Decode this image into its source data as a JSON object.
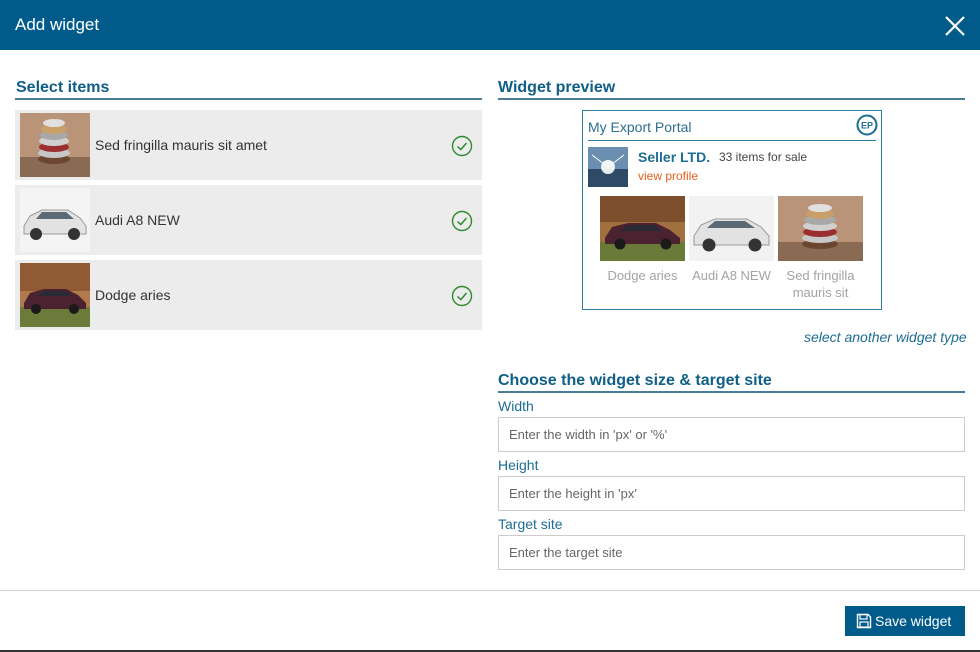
{
  "dialog": {
    "title": "Add widget",
    "close_icon": "close-icon"
  },
  "select_items": {
    "title": "Select items",
    "items": [
      {
        "label": "Sed fringilla mauris sit amet",
        "selected": true,
        "image": "rings-stack-image"
      },
      {
        "label": "Audi A8 NEW",
        "selected": true,
        "image": "white-car-image"
      },
      {
        "label": "Dodge aries",
        "selected": true,
        "image": "brown-car-image"
      }
    ]
  },
  "preview": {
    "title": "Widget preview",
    "portal_name": "My Export Portal",
    "logo_icon": "ep-logo-icon",
    "seller_name": "Seller LTD.",
    "seller_count": "33 items for sale",
    "view_profile": "view profile",
    "cards": [
      {
        "name": "Dodge aries"
      },
      {
        "name": "Audi A8 NEW"
      },
      {
        "name": "Sed fringilla mauris sit"
      }
    ],
    "another_link": "select another widget type"
  },
  "size_settings": {
    "title": "Choose the widget size & target site",
    "width_label": "Width",
    "width_value": "",
    "width_placeholder": "Enter the width in 'px' or '%'",
    "height_label": "Height",
    "height_value": "",
    "height_placeholder": "Enter the height in 'px'",
    "target_label": "Target site",
    "target_value": "",
    "target_placeholder": "Enter the target site"
  },
  "footer": {
    "save_label": "Save widget",
    "save_icon": "floppy-disk-icon"
  },
  "colors": {
    "header": "#015b8a",
    "accent": "#1d6c93",
    "link_orange": "#e8611a",
    "check_green": "#2e8b2e"
  }
}
